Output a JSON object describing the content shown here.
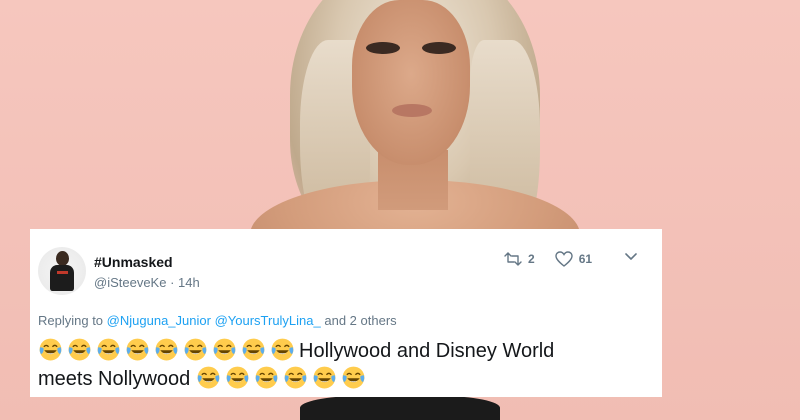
{
  "tweet": {
    "display_name": "#Unmasked",
    "handle_line": "@iSteeveKe · 14h",
    "retweet_count": "2",
    "like_count": "61",
    "replying_prefix": "Replying to",
    "replying_users": [
      "@Njuguna_Junior",
      "@YoursTrulyLina_"
    ],
    "replying_suffix": "and 2 others",
    "text_part1": "Hollywood and Disney World",
    "text_part2": "meets Nollywood",
    "emoji_name": "face-with-tears-of-joy-icon",
    "emoji_count_line1": 9,
    "emoji_count_line2": 6
  },
  "colors": {
    "link": "#1da1f2",
    "muted": "#657786",
    "text": "#14171a",
    "background": "#f5c6bd"
  }
}
